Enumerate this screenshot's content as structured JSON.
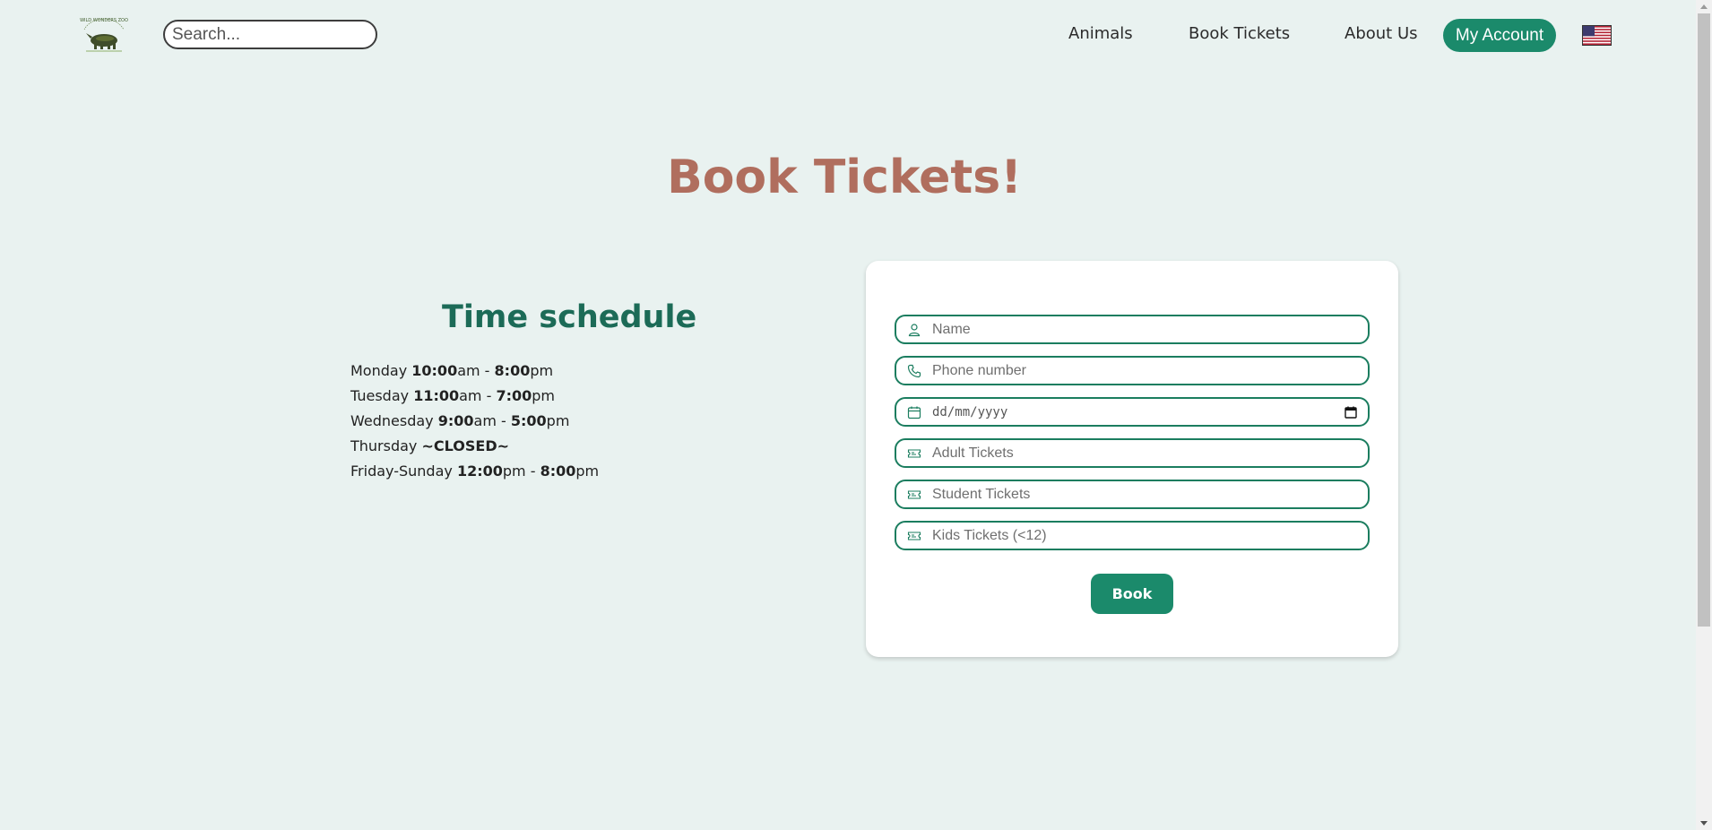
{
  "header": {
    "logo_icon": "rhino-logo-icon",
    "logo_text": "WILD WONDERS ZOO",
    "search": {
      "placeholder": "Search...",
      "value": ""
    },
    "nav": {
      "animals": "Animals",
      "book_tickets": "Book Tickets",
      "about_us": "About Us",
      "my_account": "My Account"
    },
    "language_icon": "us-flag-icon"
  },
  "page": {
    "title": "Book Tickets!"
  },
  "schedule": {
    "title": "Time schedule",
    "days": [
      {
        "day": "Monday",
        "open": "10:00",
        "open_suffix": "am",
        "sep": " - ",
        "close": "8:00",
        "close_suffix": "pm"
      },
      {
        "day": "Tuesday",
        "open": "11:00",
        "open_suffix": "am",
        "sep": " - ",
        "close": "7:00",
        "close_suffix": "pm"
      },
      {
        "day": "Wednesday",
        "open": "9:00",
        "open_suffix": "am",
        "sep": " - ",
        "close": "5:00",
        "close_suffix": "pm"
      },
      {
        "day": "Thursday",
        "closed": "~CLOSED~"
      },
      {
        "day": "Friday-Sunday",
        "open": "12:00",
        "open_suffix": "pm",
        "sep": " - ",
        "close": "8:00",
        "close_suffix": "pm"
      }
    ]
  },
  "form": {
    "name": {
      "placeholder": "Name",
      "icon": "person-icon"
    },
    "phone": {
      "placeholder": "Phone number",
      "icon": "phone-icon"
    },
    "date": {
      "placeholder": "dd/mm/yyyy",
      "icon": "calendar-icon"
    },
    "adult": {
      "placeholder": "Adult Tickets",
      "icon": "ticket-icon"
    },
    "student": {
      "placeholder": "Student Tickets",
      "icon": "ticket-icon"
    },
    "kids": {
      "placeholder": "Kids Tickets (<12)",
      "icon": "ticket-icon"
    },
    "submit_label": "Book"
  },
  "colors": {
    "background": "#e9f2f0",
    "accent": "#1b8a6b",
    "title": "#b06e5e",
    "schedule_title": "#1c6b57"
  }
}
